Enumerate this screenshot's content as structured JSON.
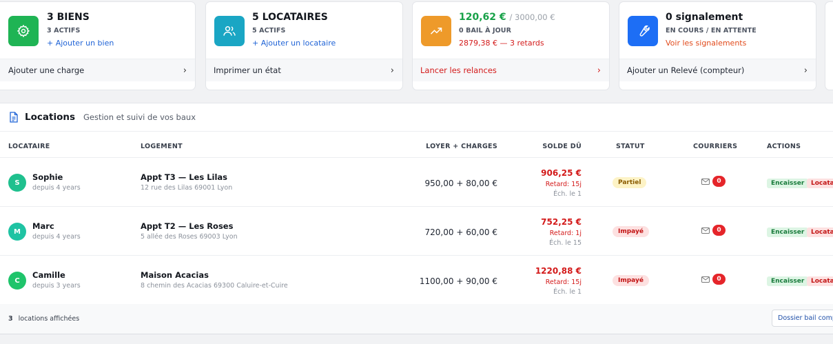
{
  "cards": [
    {
      "title": "3 BIENS",
      "subtitle": "3 ACTIFS",
      "link": "+ Ajouter un bien",
      "footer": "Ajouter une charge",
      "icon": "gear-icon"
    },
    {
      "title": "5 LOCATAIRES",
      "subtitle": "5 ACTIFS",
      "link": "+ Ajouter un locataire",
      "footer": "Imprimer un état",
      "icon": "users-icon"
    },
    {
      "amount": "120,62 €",
      "amount_total": "/ 3000,00 €",
      "subtitle": "0 BAIL À JOUR",
      "late": "2879,38 € — 3 retards",
      "footer": "Lancer les relances",
      "icon": "trending-up-icon"
    },
    {
      "title": "0 signalement",
      "subtitle": "EN COURS / EN ATTENTE",
      "link": "Voir les signalements",
      "footer": "Ajouter un Relevé (compteur)",
      "icon": "wrench-icon"
    }
  ],
  "panel": {
    "title": "Locations",
    "subtitle": "Gestion et suivi de vos baux"
  },
  "columns": {
    "locataire": "LOCATAIRE",
    "logement": "LOGEMENT",
    "loyer": "LOYER + CHARGES",
    "solde": "SOLDE DÛ",
    "statut": "STATUT",
    "courriers": "COURRIERS",
    "actions": "ACTIONS"
  },
  "rows": [
    {
      "initial": "S",
      "name": "Sophie",
      "since": "depuis 4 years",
      "logement": "Appt T3 — Les Lilas",
      "address": "12 rue des Lilas 69001 Lyon",
      "loyer": "950,00 + 80,00 €",
      "solde": "906,25 €",
      "retard": "Retard: 15j",
      "echeance": "Éch. le 1",
      "statut": "Partiel",
      "courriers": "0",
      "encaisser": "Encaisser",
      "locataire_btn": "Locataire"
    },
    {
      "initial": "M",
      "name": "Marc",
      "since": "depuis 4 years",
      "logement": "Appt T2 — Les Roses",
      "address": "5 allée des Roses 69003 Lyon",
      "loyer": "720,00 + 60,00 €",
      "solde": "752,25 €",
      "retard": "Retard: 1j",
      "echeance": "Éch. le 15",
      "statut": "Impayé",
      "courriers": "0",
      "encaisser": "Encaisser",
      "locataire_btn": "Locataire"
    },
    {
      "initial": "C",
      "name": "Camille",
      "since": "depuis 3 years",
      "logement": "Maison Acacias",
      "address": "8 chemin des Acacias 69300 Caluire-et-Cuire",
      "loyer": "1100,00 + 90,00 €",
      "solde": "1220,88 €",
      "retard": "Retard: 15j",
      "echeance": "Éch. le 1",
      "statut": "Impayé",
      "courriers": "0",
      "encaisser": "Encaisser",
      "locataire_btn": "Locataire"
    }
  ],
  "footer": {
    "count": "3",
    "label": "locations affichées",
    "dossier_btn": "Dossier bail complet"
  },
  "colors": {
    "green": "#1fb454",
    "teal": "#1aa6c4",
    "orange": "#ee9a2a",
    "blue": "#1d6ef5",
    "danger": "#d31a1a",
    "amount_green": "#17a148"
  }
}
